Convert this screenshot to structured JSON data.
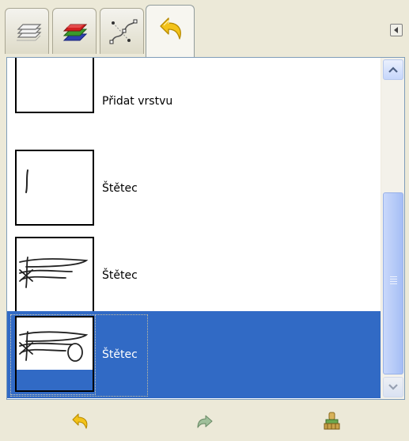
{
  "tabs": [
    {
      "icon": "layers-icon",
      "active": false
    },
    {
      "icon": "channels-icon",
      "active": false
    },
    {
      "icon": "paths-icon",
      "active": false
    },
    {
      "icon": "undo-history-icon",
      "active": true
    }
  ],
  "history": {
    "items": [
      {
        "label": "Přidat vrstvu",
        "thumbnail": "blank-canvas",
        "selected": false
      },
      {
        "label": "Štětec",
        "thumbnail": "stroke-1",
        "selected": false
      },
      {
        "label": "Štětec",
        "thumbnail": "stroke-2",
        "selected": false
      },
      {
        "label": "Štětec",
        "thumbnail": "stroke-3",
        "selected": true
      }
    ]
  },
  "toolbar": {
    "buttons": [
      {
        "icon": "undo-icon",
        "enabled": true
      },
      {
        "icon": "redo-icon",
        "enabled": false
      },
      {
        "icon": "clear-history-icon",
        "enabled": true
      }
    ]
  },
  "colors": {
    "selection": "#316ac5",
    "panel_bg": "#ece9d8",
    "scrollbar": "#c6d6fb"
  }
}
